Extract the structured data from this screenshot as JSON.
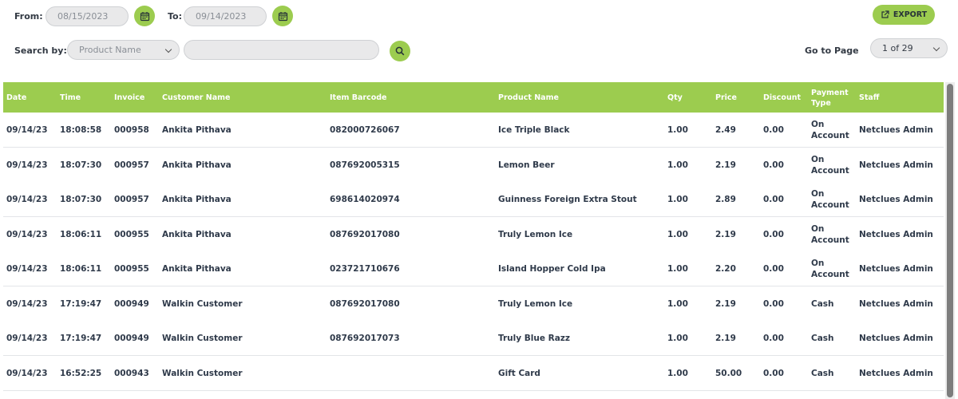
{
  "filters": {
    "from_label": "From:",
    "from_date": "08/15/2023",
    "to_label": "To:",
    "to_date": "09/14/2023",
    "search_label": "Search by:",
    "search_by_selected": "Product Name",
    "search_value": "",
    "export_label": "EXPORT",
    "goto_label": "Go to Page",
    "page_selected": "1 of 29"
  },
  "colors": {
    "accent": "#9ccc4f",
    "header_text": "#ffffff"
  },
  "table": {
    "headers": [
      "Date",
      "Time",
      "Invoice",
      "Customer Name",
      "Item Barcode",
      "Product Name",
      "Qty",
      "Price",
      "Discount",
      "Payment Type",
      "Staff"
    ],
    "rows": [
      [
        "09/14/23",
        "18:08:58",
        "000958",
        "Ankita Pithava",
        "082000726067",
        "Ice Triple Black",
        "1.00",
        "2.49",
        "0.00",
        "On Account",
        "Netclues Admin"
      ],
      [
        "09/14/23",
        "18:07:30",
        "000957",
        "Ankita Pithava",
        "087692005315",
        "Lemon Beer",
        "1.00",
        "2.19",
        "0.00",
        "On Account",
        "Netclues Admin"
      ],
      [
        "09/14/23",
        "18:07:30",
        "000957",
        "Ankita Pithava",
        "698614020974",
        "Guinness Foreign Extra Stout",
        "1.00",
        "2.89",
        "0.00",
        "On Account",
        "Netclues Admin"
      ],
      [
        "09/14/23",
        "18:06:11",
        "000955",
        "Ankita Pithava",
        "087692017080",
        "Truly Lemon Ice",
        "1.00",
        "2.19",
        "0.00",
        "On Account",
        "Netclues Admin"
      ],
      [
        "09/14/23",
        "18:06:11",
        "000955",
        "Ankita Pithava",
        "023721710676",
        "Island Hopper Cold Ipa",
        "1.00",
        "2.20",
        "0.00",
        "On Account",
        "Netclues Admin"
      ],
      [
        "09/14/23",
        "17:19:47",
        "000949",
        "Walkin Customer",
        "087692017080",
        "Truly Lemon Ice",
        "1.00",
        "2.19",
        "0.00",
        "Cash",
        "Netclues Admin"
      ],
      [
        "09/14/23",
        "17:19:47",
        "000949",
        "Walkin Customer",
        "087692017073",
        "Truly Blue Razz",
        "1.00",
        "2.19",
        "0.00",
        "Cash",
        "Netclues Admin"
      ],
      [
        "09/14/23",
        "16:52:25",
        "000943",
        "Walkin Customer",
        "",
        "Gift Card",
        "1.00",
        "50.00",
        "0.00",
        "Cash",
        "Netclues Admin"
      ]
    ]
  }
}
